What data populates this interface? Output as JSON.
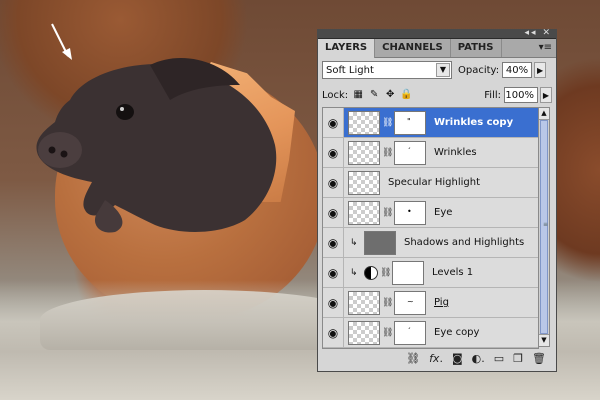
{
  "panel": {
    "tabs": [
      {
        "label": "LAYERS"
      },
      {
        "label": "CHANNELS"
      },
      {
        "label": "PATHS"
      }
    ],
    "blend_mode": "Soft Light",
    "opacity_label": "Opacity:",
    "opacity_value": "40%",
    "lock_label": "Lock:",
    "fill_label": "Fill:",
    "fill_value": "100%",
    "layers": [
      {
        "name": "Wrinkles copy",
        "selected": true
      },
      {
        "name": "Wrinkles"
      },
      {
        "name": "Specular Highlight"
      },
      {
        "name": "Eye"
      },
      {
        "name": "Shadows and Highlights"
      },
      {
        "name": "Levels 1"
      },
      {
        "name": "Pig"
      },
      {
        "name": "Eye copy"
      }
    ],
    "icons": {
      "collapse": "double-arrow-icon",
      "close": "close-icon",
      "menu": "panel-menu-icon",
      "eye": "eye-icon",
      "link": "link-icon",
      "fx": "fx-icon",
      "mask": "add-mask-icon",
      "adjustment": "adjustment-layer-icon",
      "folder": "new-group-icon",
      "new": "new-layer-icon",
      "trash": "trash-icon"
    }
  },
  "colors": {
    "selection": "#3a6fd0",
    "panel_bg": "#d6d6d6"
  }
}
